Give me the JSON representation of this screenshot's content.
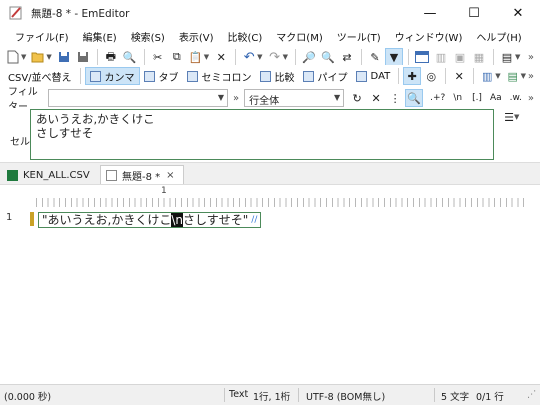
{
  "window": {
    "title": "無題-8 * - EmEditor",
    "minimize": "—",
    "maximize": "☐",
    "close": "✕"
  },
  "menu": [
    "ファイル(F)",
    "編集(E)",
    "検索(S)",
    "表示(V)",
    "比較(C)",
    "マクロ(M)",
    "ツール(T)",
    "ウィンドウ(W)",
    "ヘルプ(H)"
  ],
  "toolbar2": {
    "csv_sort": "CSV/並べ替え",
    "comma": "カンマ",
    "tab": "タブ",
    "semicolon": "セミコロン",
    "compare": "比較",
    "pipe": "パイプ",
    "dat": "DAT"
  },
  "filter": {
    "label": "フィルター",
    "scope": "行全体",
    "opts": [
      ".+?",
      "\\n",
      "[.]",
      "Aa",
      ".w."
    ]
  },
  "cell": {
    "label": "セル",
    "line1": "あいうえお,かきくけこ",
    "line2": "さしすせそ"
  },
  "tabs": [
    {
      "label": "KEN_ALL.CSV"
    },
    {
      "label": "無題-8 *",
      "close": "×"
    }
  ],
  "editor": {
    "ruler_number": "1",
    "line_number": "1",
    "text_before": "\"あいうえお,かきくけこ",
    "text_highlight": "\\n",
    "text_after": "さしすせそ\"",
    "eol_mark": "//"
  },
  "status": {
    "time": "(0.000 秒)",
    "mode": "Text",
    "position": "1行, 1桁",
    "encoding": "UTF-8 (BOM無し)",
    "chars": "5 文字",
    "lines": "0/1 行"
  },
  "accent_colors": {
    "border": "#4c8a5a",
    "marker": "#c9a227",
    "active_toggle": "#cce4f7"
  }
}
